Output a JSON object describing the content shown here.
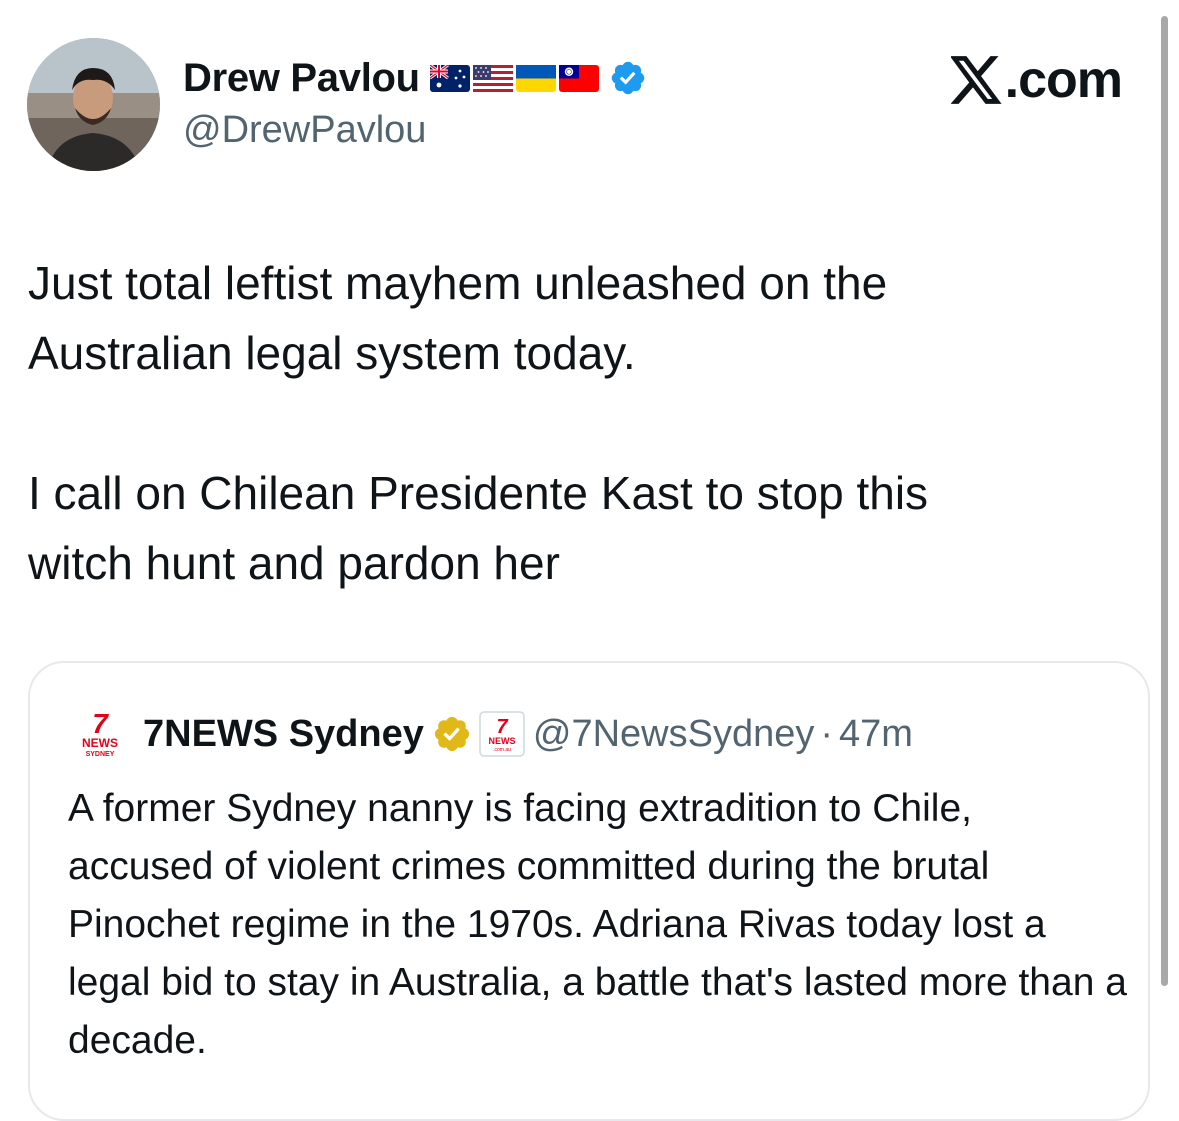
{
  "author": {
    "display_name": "Drew Pavlou",
    "handle": "@DrewPavlou",
    "flags": [
      "australia-flag-icon",
      "usa-flag-icon",
      "ukraine-flag-icon",
      "taiwan-flag-icon"
    ],
    "verified_icon": "verified-badge-icon"
  },
  "brand": {
    "logo": "x-logo-icon",
    "text": ".com"
  },
  "tweet": {
    "text": "Just total leftist mayhem unleashed on the\nAustralian legal system today.\n\nI call on Chilean Presidente Kast to stop this\nwitch hunt and pardon her"
  },
  "quote": {
    "display_name": "7NEWS Sydney",
    "handle": "@7NewsSydney",
    "separator": "·",
    "time": "47m",
    "logo_text": {
      "seven": "7",
      "news": "NEWS",
      "city": "SYDNEY",
      "domain": ".com.au"
    },
    "text": "A former Sydney nanny is facing extradition to Chile, accused of violent crimes committed during the brutal Pinochet regime in the 1970s. Adriana Rivas today lost a legal bid to stay in Australia, a battle that's lasted more than a decade."
  },
  "colors": {
    "text": "#0f1419",
    "secondary": "#536471",
    "verified_blue": "#1d9bf0",
    "verified_gold": "#e2b719",
    "seven_red": "#e3001b"
  }
}
